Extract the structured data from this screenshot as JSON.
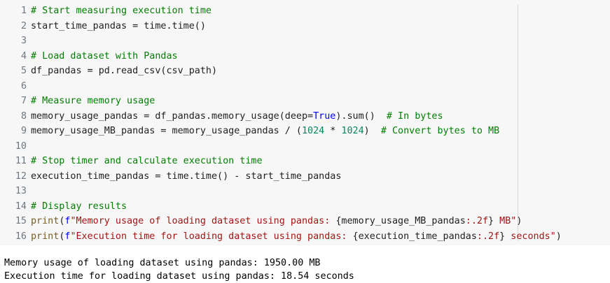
{
  "code": {
    "lines": [
      {
        "num": "1",
        "tokens": [
          {
            "t": "c",
            "v": "# Start measuring execution time"
          }
        ]
      },
      {
        "num": "2",
        "tokens": [
          {
            "t": "p",
            "v": "start_time_pandas = time.time()"
          }
        ]
      },
      {
        "num": "3",
        "tokens": []
      },
      {
        "num": "4",
        "tokens": [
          {
            "t": "c",
            "v": "# Load dataset with Pandas"
          }
        ]
      },
      {
        "num": "5",
        "tokens": [
          {
            "t": "p",
            "v": "df_pandas = pd.read_csv(csv_path)"
          }
        ]
      },
      {
        "num": "6",
        "tokens": []
      },
      {
        "num": "7",
        "tokens": [
          {
            "t": "c",
            "v": "# Measure memory usage"
          }
        ]
      },
      {
        "num": "8",
        "tokens": [
          {
            "t": "p",
            "v": "memory_usage_pandas = df_pandas.memory_usage(deep="
          },
          {
            "t": "k",
            "v": "True"
          },
          {
            "t": "p",
            "v": ").sum()  "
          },
          {
            "t": "c",
            "v": "# In bytes"
          }
        ]
      },
      {
        "num": "9",
        "tokens": [
          {
            "t": "p",
            "v": "memory_usage_MB_pandas = memory_usage_pandas / ("
          },
          {
            "t": "n",
            "v": "1024"
          },
          {
            "t": "p",
            "v": " * "
          },
          {
            "t": "n",
            "v": "1024"
          },
          {
            "t": "p",
            "v": ")  "
          },
          {
            "t": "c",
            "v": "# Convert bytes to MB"
          }
        ]
      },
      {
        "num": "10",
        "tokens": []
      },
      {
        "num": "11",
        "tokens": [
          {
            "t": "c",
            "v": "# Stop timer and calculate execution time"
          }
        ]
      },
      {
        "num": "12",
        "tokens": [
          {
            "t": "p",
            "v": "execution_time_pandas = time.time() - start_time_pandas"
          }
        ]
      },
      {
        "num": "13",
        "tokens": []
      },
      {
        "num": "14",
        "tokens": [
          {
            "t": "c",
            "v": "# Display results"
          }
        ]
      },
      {
        "num": "15",
        "tokens": [
          {
            "t": "f",
            "v": "print"
          },
          {
            "t": "p",
            "v": "("
          },
          {
            "t": "k",
            "v": "f"
          },
          {
            "t": "s",
            "v": "\"Memory usage of loading dataset using pandas: "
          },
          {
            "t": "p",
            "v": "{memory_usage_MB_pandas"
          },
          {
            "t": "s",
            "v": ":.2f"
          },
          {
            "t": "p",
            "v": "}"
          },
          {
            "t": "s",
            "v": " MB\""
          },
          {
            "t": "p",
            "v": ")"
          }
        ]
      },
      {
        "num": "16",
        "tokens": [
          {
            "t": "f",
            "v": "print"
          },
          {
            "t": "p",
            "v": "("
          },
          {
            "t": "k",
            "v": "f"
          },
          {
            "t": "s",
            "v": "\"Execution time for loading dataset using pandas: "
          },
          {
            "t": "p",
            "v": "{execution_time_pandas"
          },
          {
            "t": "s",
            "v": ":.2f"
          },
          {
            "t": "p",
            "v": "}"
          },
          {
            "t": "s",
            "v": " seconds\""
          },
          {
            "t": "p",
            "v": ")"
          }
        ]
      }
    ]
  },
  "output": {
    "lines": [
      "Memory usage of loading dataset using pandas: 1950.00 MB",
      "Execution time for loading dataset using pandas: 18.54 seconds"
    ]
  }
}
